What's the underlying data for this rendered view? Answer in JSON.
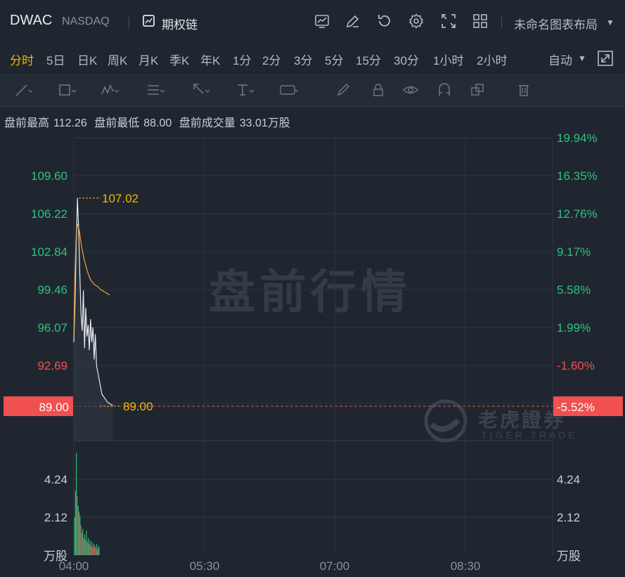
{
  "header": {
    "symbol": "DWAC",
    "exchange": "NASDAQ",
    "option_chain": "期权链",
    "layout": "未命名图表布局"
  },
  "periods": [
    "分时",
    "5日",
    "日K",
    "周K",
    "月K",
    "季K",
    "年K",
    "1分",
    "2分",
    "3分",
    "5分",
    "15分",
    "30分",
    "1小时",
    "2小时"
  ],
  "active_period": "分时",
  "auto_label": "自动",
  "info": {
    "high_label": "盘前最高",
    "high": "112.26",
    "low_label": "盘前最低",
    "low": "88.00",
    "vol_label": "盘前成交量",
    "vol": "33.01万股"
  },
  "watermark": "盘前行情",
  "brand": {
    "cn": "老虎證券",
    "en": "TIGER TRADE"
  },
  "colors": {
    "up": "#2ec27e",
    "down": "#f0504f",
    "price_line": "#e9ecef",
    "avg_line": "#f2a33a",
    "accent": "#f2b705"
  },
  "chart_data": {
    "type": "line",
    "x_ticks": [
      "04:00",
      "05:30",
      "07:00",
      "08:30"
    ],
    "left_axis": [
      "109.60",
      "106.22",
      "102.84",
      "99.46",
      "96.07",
      "92.69",
      "89.00"
    ],
    "right_axis": [
      "19.94%",
      "16.35%",
      "12.76%",
      "9.17%",
      "5.58%",
      "1.99%",
      "-1.60%",
      "-5.52%"
    ],
    "ylim": [
      85.95,
      112.26
    ],
    "current_price": "89.00",
    "current_pct": "-5.52%",
    "max_label": "107.02",
    "min_label": "89.00",
    "price_series": [
      94.5,
      98.0,
      103.0,
      107.02,
      104.5,
      100.5,
      97.0,
      95.5,
      99.0,
      94.0,
      97.5,
      95.0,
      96.0,
      93.8,
      96.5,
      94.5,
      95.8,
      93.0,
      95.2,
      92.5,
      90.0,
      89.3,
      89.0
    ],
    "avg_series": [
      95.0,
      100.5,
      103.8,
      104.8,
      104.2,
      103.0,
      102.1,
      101.4,
      100.8,
      100.3,
      99.9,
      99.7,
      99.5,
      99.4,
      99.3,
      99.1,
      99.0,
      98.9,
      98.8,
      98.7,
      98.6
    ],
    "volume_axis": [
      "4.24",
      "2.12"
    ],
    "volume_unit": "万股",
    "volumes": [
      2.0,
      3.4,
      5.4,
      3.1,
      2.6,
      2.3,
      2.1,
      1.6,
      1.2,
      1.4,
      0.9,
      1.1,
      0.8,
      1.3,
      0.7,
      0.9,
      0.6,
      0.8,
      0.5,
      0.7,
      0.4,
      0.6,
      0.5,
      0.4,
      0.6,
      0.3,
      0.5,
      0.4
    ],
    "volume_dirs": [
      "up",
      "up",
      "up",
      "down",
      "up",
      "down",
      "up",
      "down",
      "down",
      "up",
      "down",
      "up",
      "down",
      "up",
      "down",
      "up",
      "down",
      "up",
      "down",
      "up",
      "down",
      "up",
      "down",
      "down",
      "up",
      "down",
      "up",
      "down"
    ]
  }
}
